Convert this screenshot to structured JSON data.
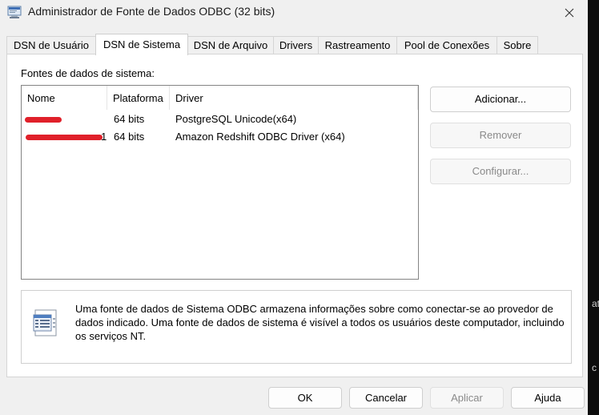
{
  "window": {
    "title": "Administrador de Fonte de Dados ODBC (32 bits)",
    "close_label": "✕"
  },
  "tabs": [
    {
      "label": "DSN de Usuário",
      "active": false
    },
    {
      "label": "DSN de Sistema",
      "active": true
    },
    {
      "label": "DSN de Arquivo",
      "active": false
    },
    {
      "label": "Drivers",
      "active": false
    },
    {
      "label": "Rastreamento",
      "active": false
    },
    {
      "label": "Pool de Conexões",
      "active": false
    },
    {
      "label": "Sobre",
      "active": false
    }
  ],
  "sources": {
    "group_label": "Fontes de dados de sistema:",
    "columns": [
      "Nome",
      "Plataforma",
      "Driver"
    ],
    "rows": [
      {
        "name": "",
        "platform": "64 bits",
        "driver": "PostgreSQL Unicode(x64)",
        "redacted": true
      },
      {
        "name": "1",
        "platform": "64 bits",
        "driver": "Amazon Redshift ODBC Driver (x64)",
        "redacted": true
      }
    ]
  },
  "side_buttons": {
    "add": "Adicionar...",
    "remove": "Remover",
    "configure": "Configurar..."
  },
  "info": {
    "text": "Uma fonte de dados de Sistema ODBC armazena informações sobre como conectar-se ao provedor de dados indicado. Uma fonte de dados de sistema é visível a todos os usuários deste computador, incluindo os serviços NT.",
    "icon": "data-source-document-icon"
  },
  "footer": {
    "ok": "OK",
    "cancel": "Cancelar",
    "apply": "Aplicar",
    "help": "Ajuda"
  },
  "background_window": {
    "chars": [
      "at",
      "c"
    ]
  },
  "colors": {
    "redaction": "#e0202a",
    "window_bg": "#f0f0f0",
    "disabled_text": "#8a8a8a"
  }
}
